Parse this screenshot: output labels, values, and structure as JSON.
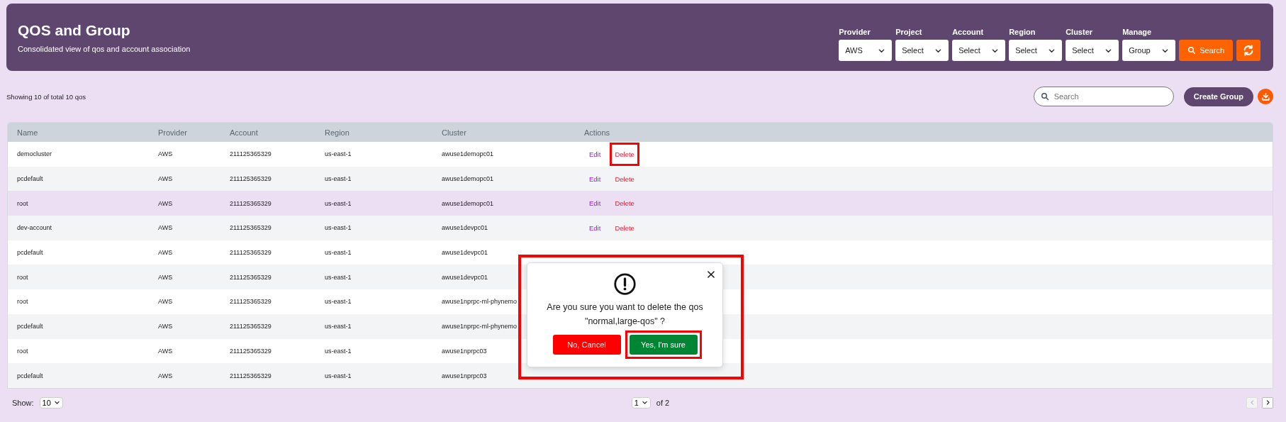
{
  "header": {
    "title": "QOS and Group",
    "subtitle": "Consolidated view of qos and account association",
    "filters": [
      {
        "label": "Provider",
        "value": "AWS"
      },
      {
        "label": "Project",
        "value": "Select"
      },
      {
        "label": "Account",
        "value": "Select"
      },
      {
        "label": "Region",
        "value": "Select"
      },
      {
        "label": "Cluster",
        "value": "Select"
      },
      {
        "label": "Manage",
        "value": "Group"
      }
    ],
    "search_button": "Search"
  },
  "toolbar": {
    "summary": "Showing 10 of total 10 qos",
    "search": {
      "placeholder": "Search"
    },
    "create_button": "Create Group"
  },
  "table": {
    "columns": [
      "Name",
      "Provider",
      "Account",
      "Region",
      "Cluster",
      "Actions"
    ],
    "rows": [
      {
        "cells": [
          "democluster",
          "AWS",
          "211125365329",
          "us-east-1",
          "awuse1demopc01"
        ],
        "hovered": false,
        "actions": [
          {
            "label": "Edit",
            "kind": "edit",
            "highlighted": false
          },
          {
            "label": "Delete",
            "kind": "delete",
            "highlighted": true
          }
        ]
      },
      {
        "cells": [
          "pcdefault",
          "AWS",
          "211125365329",
          "us-east-1",
          "awuse1demopc01"
        ],
        "hovered": false,
        "actions": [
          {
            "label": "Edit",
            "kind": "edit",
            "highlighted": false
          },
          {
            "label": "Delete",
            "kind": "delete",
            "highlighted": false
          }
        ]
      },
      {
        "cells": [
          "root",
          "AWS",
          "211125365329",
          "us-east-1",
          "awuse1demopc01"
        ],
        "hovered": true,
        "actions": [
          {
            "label": "Edit",
            "kind": "edit",
            "highlighted": false
          },
          {
            "label": "Delete",
            "kind": "delete",
            "highlighted": false
          }
        ]
      },
      {
        "cells": [
          "dev-account",
          "AWS",
          "211125365329",
          "us-east-1",
          "awuse1devpc01"
        ],
        "hovered": false,
        "actions": [
          {
            "label": "Edit",
            "kind": "edit",
            "highlighted": false
          },
          {
            "label": "Delete",
            "kind": "delete",
            "highlighted": false
          }
        ]
      },
      {
        "cells": [
          "pcdefault",
          "AWS",
          "211125365329",
          "us-east-1",
          "awuse1devpc01"
        ],
        "hovered": false
      },
      {
        "cells": [
          "root",
          "AWS",
          "211125365329",
          "us-east-1",
          "awuse1devpc01"
        ],
        "hovered": false
      },
      {
        "cells": [
          "root",
          "AWS",
          "211125365329",
          "us-east-1",
          "awuse1nprpc-ml-phynemo"
        ],
        "hovered": false
      },
      {
        "cells": [
          "pcdefault",
          "AWS",
          "211125365329",
          "us-east-1",
          "awuse1nprpc-ml-phynemo"
        ],
        "hovered": false
      },
      {
        "cells": [
          "root",
          "AWS",
          "211125365329",
          "us-east-1",
          "awuse1nprpc03"
        ],
        "hovered": false
      },
      {
        "cells": [
          "pcdefault",
          "AWS",
          "211125365329",
          "us-east-1",
          "awuse1nprpc03"
        ],
        "hovered": false
      }
    ]
  },
  "footer": {
    "show_label": "Show:",
    "page_size": "10",
    "page": "1",
    "page_total": "of 2"
  },
  "dialog": {
    "message": "Are you sure you want to delete the qos\n\"normal,large-qos\" ?",
    "cancel_button": "No, Cancel",
    "confirm_button": "Yes, I'm sure",
    "highlighted": true,
    "confirm_highlighted": true
  }
}
